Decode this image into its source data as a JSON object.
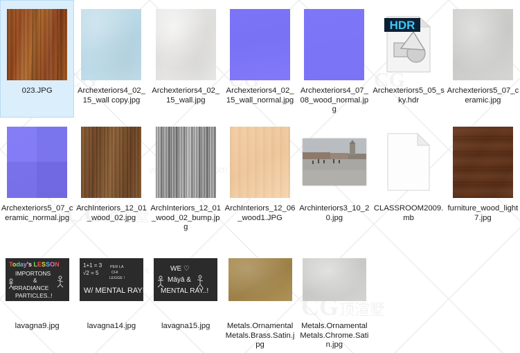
{
  "view": {
    "name": "file-explorer-grid",
    "background_color": "#ffffff",
    "selection_color": "#dbeefb",
    "selection_border_color": "#b9dcf2",
    "label_color": "#1b1b1b",
    "columns": 7,
    "watermark_text": "CG"
  },
  "files": [
    {
      "name": "023.JPG",
      "kind": "image-thumbnail",
      "selected": true,
      "thumb": "tex-wood023",
      "shape": "square",
      "swatch_color": "#9c5322"
    },
    {
      "name": "Archexteriors4_02_15_wall copy.jpg",
      "kind": "image-thumbnail",
      "selected": false,
      "thumb": "tex-bluewall",
      "shape": "square",
      "swatch_color": "#bedbe8"
    },
    {
      "name": "Archexteriors4_02_15_wall.jpg",
      "kind": "image-thumbnail",
      "selected": false,
      "thumb": "tex-whitewall",
      "shape": "square",
      "swatch_color": "#e4e4e2"
    },
    {
      "name": "Archexteriors4_02_15_wall_normal.jpg",
      "kind": "image-thumbnail",
      "selected": false,
      "thumb": "tex-normal",
      "shape": "square",
      "swatch_color": "#7b74f6"
    },
    {
      "name": "Archexteriors4_07_08_wood_normal.jpg",
      "kind": "image-thumbnail",
      "selected": false,
      "thumb": "tex-normal2",
      "shape": "square",
      "swatch_color": "#7d76f7"
    },
    {
      "name": "Archexteriors5_05_sky.hdr",
      "kind": "hdr-file-icon",
      "selected": false,
      "thumb": "icon-hdr",
      "shape": "document",
      "swatch_color": "#102030",
      "badge": "HDR"
    },
    {
      "name": "Archexteriors5_07_ceramic.jpg",
      "kind": "image-thumbnail",
      "selected": false,
      "thumb": "tex-ceramic",
      "shape": "square",
      "swatch_color": "#cfcfcd"
    },
    {
      "name": "Archexteriors5_07_ceramic_normal.jpg",
      "kind": "image-thumbnail",
      "selected": false,
      "thumb": "tex-normal3",
      "shape": "square",
      "swatch_color": "#7b74f6"
    },
    {
      "name": "ArchInteriors_12_01_wood_02.jpg",
      "kind": "image-thumbnail",
      "selected": false,
      "thumb": "tex-wood12",
      "shape": "square",
      "swatch_color": "#7c5530"
    },
    {
      "name": "ArchInteriors_12_01_wood_02_bump.jpg",
      "kind": "image-thumbnail",
      "selected": false,
      "thumb": "tex-bump12",
      "shape": "square",
      "swatch_color": "#a8a8a8"
    },
    {
      "name": "ArchInteriors_12_06_wood1.JPG",
      "kind": "image-thumbnail",
      "selected": false,
      "thumb": "tex-tan",
      "shape": "square",
      "swatch_color": "#f0c89a"
    },
    {
      "name": "Archinteriors3_10_20.jpg",
      "kind": "photo-thumbnail",
      "selected": false,
      "thumb": "photo-square",
      "shape": "photo",
      "swatch_color": "#9b9b99"
    },
    {
      "name": "CLASSROOM2009.mb",
      "kind": "generic-file-icon",
      "selected": false,
      "thumb": "icon-blank",
      "shape": "document",
      "swatch_color": "#fdfdfd"
    },
    {
      "name": "furniture_wood_light7.jpg",
      "kind": "image-thumbnail",
      "selected": false,
      "thumb": "tex-furniture",
      "shape": "square",
      "swatch_color": "#613319"
    },
    {
      "name": "lavagna9.jpg",
      "kind": "image-thumbnail",
      "selected": false,
      "thumb": "blackboard-9",
      "shape": "landscape",
      "swatch_color": "#2a2a2a"
    },
    {
      "name": "lavagna14.jpg",
      "kind": "image-thumbnail",
      "selected": false,
      "thumb": "blackboard-14",
      "shape": "landscape",
      "swatch_color": "#2a2a2a"
    },
    {
      "name": "lavagna15.jpg",
      "kind": "image-thumbnail",
      "selected": false,
      "thumb": "blackboard-15",
      "shape": "landscape",
      "swatch_color": "#2a2a2a"
    },
    {
      "name": "Metals.Ornamental Metals.Brass.Satin.jpg",
      "kind": "image-thumbnail",
      "selected": false,
      "thumb": "tex-brass",
      "shape": "landscape",
      "swatch_color": "#a98c50"
    },
    {
      "name": "Metals.Ornamental Metals.Chrome.Satin.jpg",
      "kind": "image-thumbnail",
      "selected": false,
      "thumb": "tex-chrome",
      "shape": "landscape",
      "swatch_color": "#cececc"
    }
  ],
  "blackboards": {
    "lavagna9": {
      "line1": "Today's Lesson",
      "line2": "IMPORTONS",
      "line3": "&",
      "line4": "IRRADIANCE",
      "line5": "PARTICLES..!"
    },
    "lavagna14": {
      "line1": "1+1 = 3",
      "line2": "√2 = 5",
      "line3": "PER LA",
      "line4": "CHI",
      "line5": "LEGGE !",
      "line6": "W/ MENTAL RAY!"
    },
    "lavagna15": {
      "line1": "WE ♡",
      "line2": "Māyā &",
      "line3": "MENTAL RAY..!"
    }
  }
}
